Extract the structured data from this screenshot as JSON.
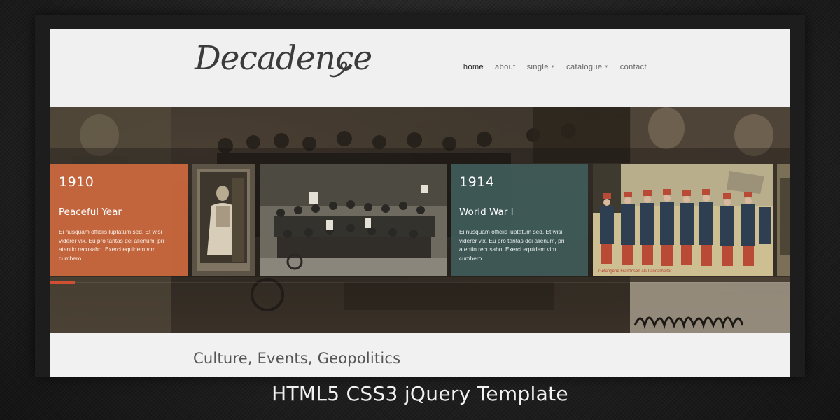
{
  "site": {
    "logo_text": "Decadence",
    "nav": [
      {
        "label": "home",
        "active": true,
        "dropdown": false
      },
      {
        "label": "about",
        "active": false,
        "dropdown": false
      },
      {
        "label": "single",
        "active": false,
        "dropdown": true
      },
      {
        "label": "catalogue",
        "active": false,
        "dropdown": true
      },
      {
        "label": "contact",
        "active": false,
        "dropdown": false
      }
    ]
  },
  "slider": {
    "slides": [
      {
        "year": "1910",
        "title": "Peaceful Year",
        "body": "Ei nusquam officiis luptatum sed. Et wisi viderer vix. Eu pro tantas dei alienum, pri atentio recusabo. Exerci equidem vim cumbero.",
        "color": "#ce693e"
      },
      {
        "year": "1914",
        "title": "World War I",
        "body": "Ei nusquam officiis luptatum sed. Et wisi viderer vix. Eu pro tantas dei alienum, pri atentio recusabo. Exerci equidem vim cumbero.",
        "color": "#405c5a"
      }
    ],
    "photo_captions": {
      "soldiers": "Gefangene Franzosen als Landarbeiter"
    },
    "progress": 0.033,
    "progress_color": "#cf4f32"
  },
  "section": {
    "title": "Culture, Events, Geopolitics"
  },
  "caption": "HTML5 CSS3 jQuery Template"
}
